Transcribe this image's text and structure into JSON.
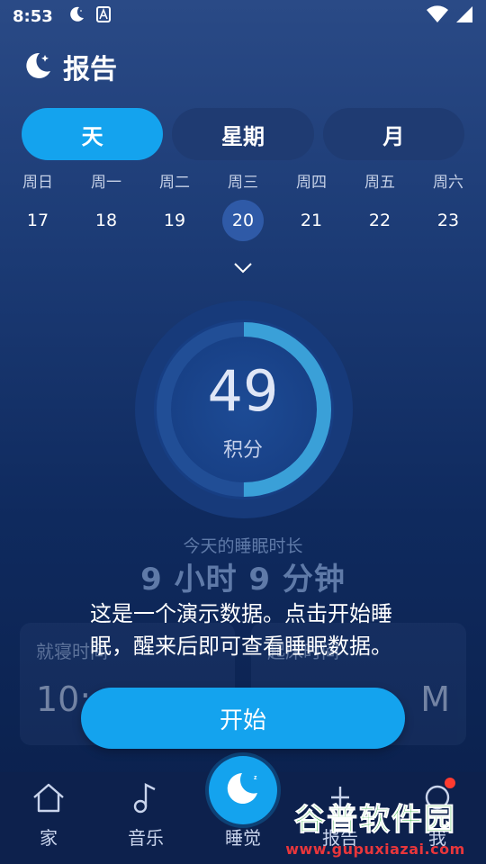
{
  "status_bar": {
    "time": "8:53"
  },
  "header": {
    "title": "报告"
  },
  "tabs": [
    {
      "label": "天",
      "active": true
    },
    {
      "label": "星期",
      "active": false
    },
    {
      "label": "月",
      "active": false
    }
  ],
  "weekdays": [
    "周日",
    "周一",
    "周二",
    "周三",
    "周四",
    "周五",
    "周六"
  ],
  "dates": [
    "17",
    "18",
    "19",
    "20",
    "21",
    "22",
    "23"
  ],
  "selected_date": "20",
  "score": {
    "value": "49",
    "label": "积分",
    "progress": 0.5
  },
  "sleep": {
    "caption": "今天的睡眠时长",
    "duration": "9 小时 9 分钟"
  },
  "cards": {
    "bedtime": {
      "label": "就寝时间",
      "value": "10:"
    },
    "waketime": {
      "label": "起床时间",
      "value": "M"
    }
  },
  "overlay": {
    "message": "这是一个演示数据。点击开始睡眠，醒来后即可查看睡眠数据。",
    "button": "开始"
  },
  "nav": {
    "home": "家",
    "music": "音乐",
    "sleep": "睡觉",
    "report": "报告",
    "me": "我"
  },
  "watermark": {
    "title": "谷普软件园",
    "url": "www.gupuxiazai.com"
  },
  "colors": {
    "accent": "#14a3ee",
    "ring_track": "#1f4a8f",
    "ring_progress": "#3aa0d8"
  }
}
